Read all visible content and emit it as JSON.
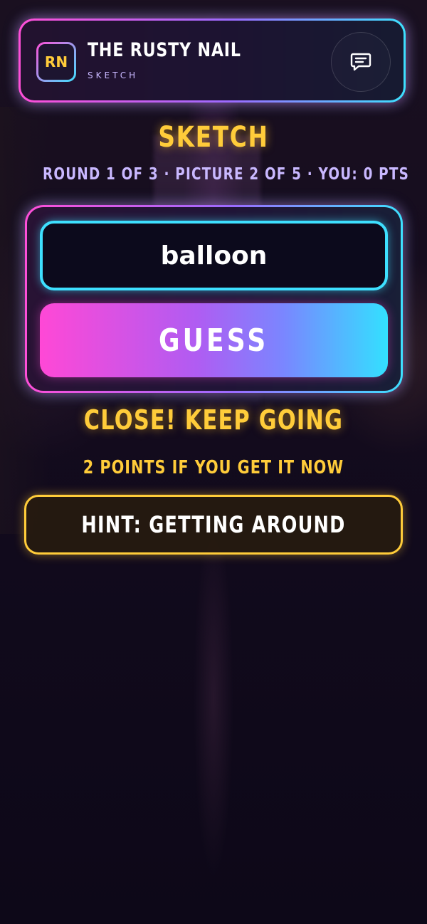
{
  "header": {
    "logo_initials": "RN",
    "venue_name": "THE RUSTY NAIL",
    "venue_subtitle": "SKETCH",
    "chat_icon": "chat-icon"
  },
  "game": {
    "title": "SKETCH",
    "status": "ROUND 1 OF 3 · PICTURE 2 OF 5 · YOU: 0 PTS"
  },
  "guess": {
    "input_value": "balloon",
    "button_label": "GUESS"
  },
  "feedback": {
    "message": "CLOSE! KEEP GOING",
    "points_note": "2 POINTS IF YOU GET IT NOW"
  },
  "hint": {
    "label": "HINT: GETTING AROUND"
  },
  "colors": {
    "accent_yellow": "#ffcc3a",
    "neon_pink": "#ff4fd8",
    "neon_cyan": "#3ee0ff",
    "lavender": "#c9b8ff",
    "background": "#0d0818"
  }
}
